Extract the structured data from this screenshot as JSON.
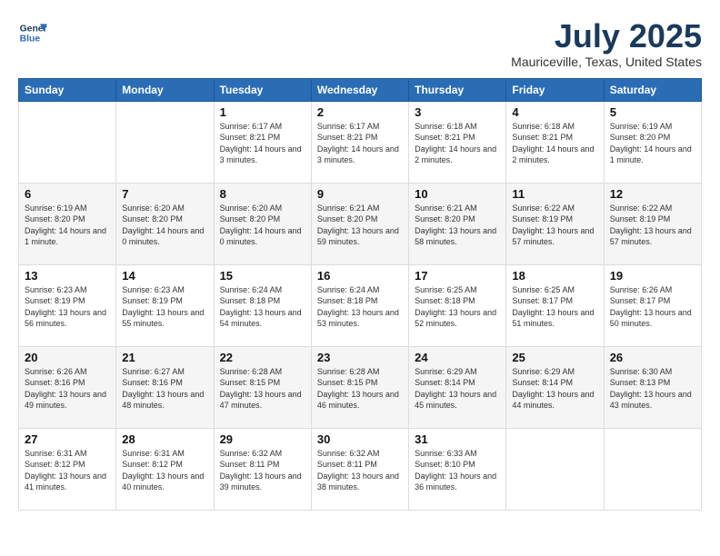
{
  "header": {
    "logo_line1": "General",
    "logo_line2": "Blue",
    "month_year": "July 2025",
    "location": "Mauriceville, Texas, United States"
  },
  "days_of_week": [
    "Sunday",
    "Monday",
    "Tuesday",
    "Wednesday",
    "Thursday",
    "Friday",
    "Saturday"
  ],
  "weeks": [
    [
      {
        "day": "",
        "info": ""
      },
      {
        "day": "",
        "info": ""
      },
      {
        "day": "1",
        "info": "Sunrise: 6:17 AM\nSunset: 8:21 PM\nDaylight: 14 hours and 3 minutes."
      },
      {
        "day": "2",
        "info": "Sunrise: 6:17 AM\nSunset: 8:21 PM\nDaylight: 14 hours and 3 minutes."
      },
      {
        "day": "3",
        "info": "Sunrise: 6:18 AM\nSunset: 8:21 PM\nDaylight: 14 hours and 2 minutes."
      },
      {
        "day": "4",
        "info": "Sunrise: 6:18 AM\nSunset: 8:21 PM\nDaylight: 14 hours and 2 minutes."
      },
      {
        "day": "5",
        "info": "Sunrise: 6:19 AM\nSunset: 8:20 PM\nDaylight: 14 hours and 1 minute."
      }
    ],
    [
      {
        "day": "6",
        "info": "Sunrise: 6:19 AM\nSunset: 8:20 PM\nDaylight: 14 hours and 1 minute."
      },
      {
        "day": "7",
        "info": "Sunrise: 6:20 AM\nSunset: 8:20 PM\nDaylight: 14 hours and 0 minutes."
      },
      {
        "day": "8",
        "info": "Sunrise: 6:20 AM\nSunset: 8:20 PM\nDaylight: 14 hours and 0 minutes."
      },
      {
        "day": "9",
        "info": "Sunrise: 6:21 AM\nSunset: 8:20 PM\nDaylight: 13 hours and 59 minutes."
      },
      {
        "day": "10",
        "info": "Sunrise: 6:21 AM\nSunset: 8:20 PM\nDaylight: 13 hours and 58 minutes."
      },
      {
        "day": "11",
        "info": "Sunrise: 6:22 AM\nSunset: 8:19 PM\nDaylight: 13 hours and 57 minutes."
      },
      {
        "day": "12",
        "info": "Sunrise: 6:22 AM\nSunset: 8:19 PM\nDaylight: 13 hours and 57 minutes."
      }
    ],
    [
      {
        "day": "13",
        "info": "Sunrise: 6:23 AM\nSunset: 8:19 PM\nDaylight: 13 hours and 56 minutes."
      },
      {
        "day": "14",
        "info": "Sunrise: 6:23 AM\nSunset: 8:19 PM\nDaylight: 13 hours and 55 minutes."
      },
      {
        "day": "15",
        "info": "Sunrise: 6:24 AM\nSunset: 8:18 PM\nDaylight: 13 hours and 54 minutes."
      },
      {
        "day": "16",
        "info": "Sunrise: 6:24 AM\nSunset: 8:18 PM\nDaylight: 13 hours and 53 minutes."
      },
      {
        "day": "17",
        "info": "Sunrise: 6:25 AM\nSunset: 8:18 PM\nDaylight: 13 hours and 52 minutes."
      },
      {
        "day": "18",
        "info": "Sunrise: 6:25 AM\nSunset: 8:17 PM\nDaylight: 13 hours and 51 minutes."
      },
      {
        "day": "19",
        "info": "Sunrise: 6:26 AM\nSunset: 8:17 PM\nDaylight: 13 hours and 50 minutes."
      }
    ],
    [
      {
        "day": "20",
        "info": "Sunrise: 6:26 AM\nSunset: 8:16 PM\nDaylight: 13 hours and 49 minutes."
      },
      {
        "day": "21",
        "info": "Sunrise: 6:27 AM\nSunset: 8:16 PM\nDaylight: 13 hours and 48 minutes."
      },
      {
        "day": "22",
        "info": "Sunrise: 6:28 AM\nSunset: 8:15 PM\nDaylight: 13 hours and 47 minutes."
      },
      {
        "day": "23",
        "info": "Sunrise: 6:28 AM\nSunset: 8:15 PM\nDaylight: 13 hours and 46 minutes."
      },
      {
        "day": "24",
        "info": "Sunrise: 6:29 AM\nSunset: 8:14 PM\nDaylight: 13 hours and 45 minutes."
      },
      {
        "day": "25",
        "info": "Sunrise: 6:29 AM\nSunset: 8:14 PM\nDaylight: 13 hours and 44 minutes."
      },
      {
        "day": "26",
        "info": "Sunrise: 6:30 AM\nSunset: 8:13 PM\nDaylight: 13 hours and 43 minutes."
      }
    ],
    [
      {
        "day": "27",
        "info": "Sunrise: 6:31 AM\nSunset: 8:12 PM\nDaylight: 13 hours and 41 minutes."
      },
      {
        "day": "28",
        "info": "Sunrise: 6:31 AM\nSunset: 8:12 PM\nDaylight: 13 hours and 40 minutes."
      },
      {
        "day": "29",
        "info": "Sunrise: 6:32 AM\nSunset: 8:11 PM\nDaylight: 13 hours and 39 minutes."
      },
      {
        "day": "30",
        "info": "Sunrise: 6:32 AM\nSunset: 8:11 PM\nDaylight: 13 hours and 38 minutes."
      },
      {
        "day": "31",
        "info": "Sunrise: 6:33 AM\nSunset: 8:10 PM\nDaylight: 13 hours and 36 minutes."
      },
      {
        "day": "",
        "info": ""
      },
      {
        "day": "",
        "info": ""
      }
    ]
  ]
}
